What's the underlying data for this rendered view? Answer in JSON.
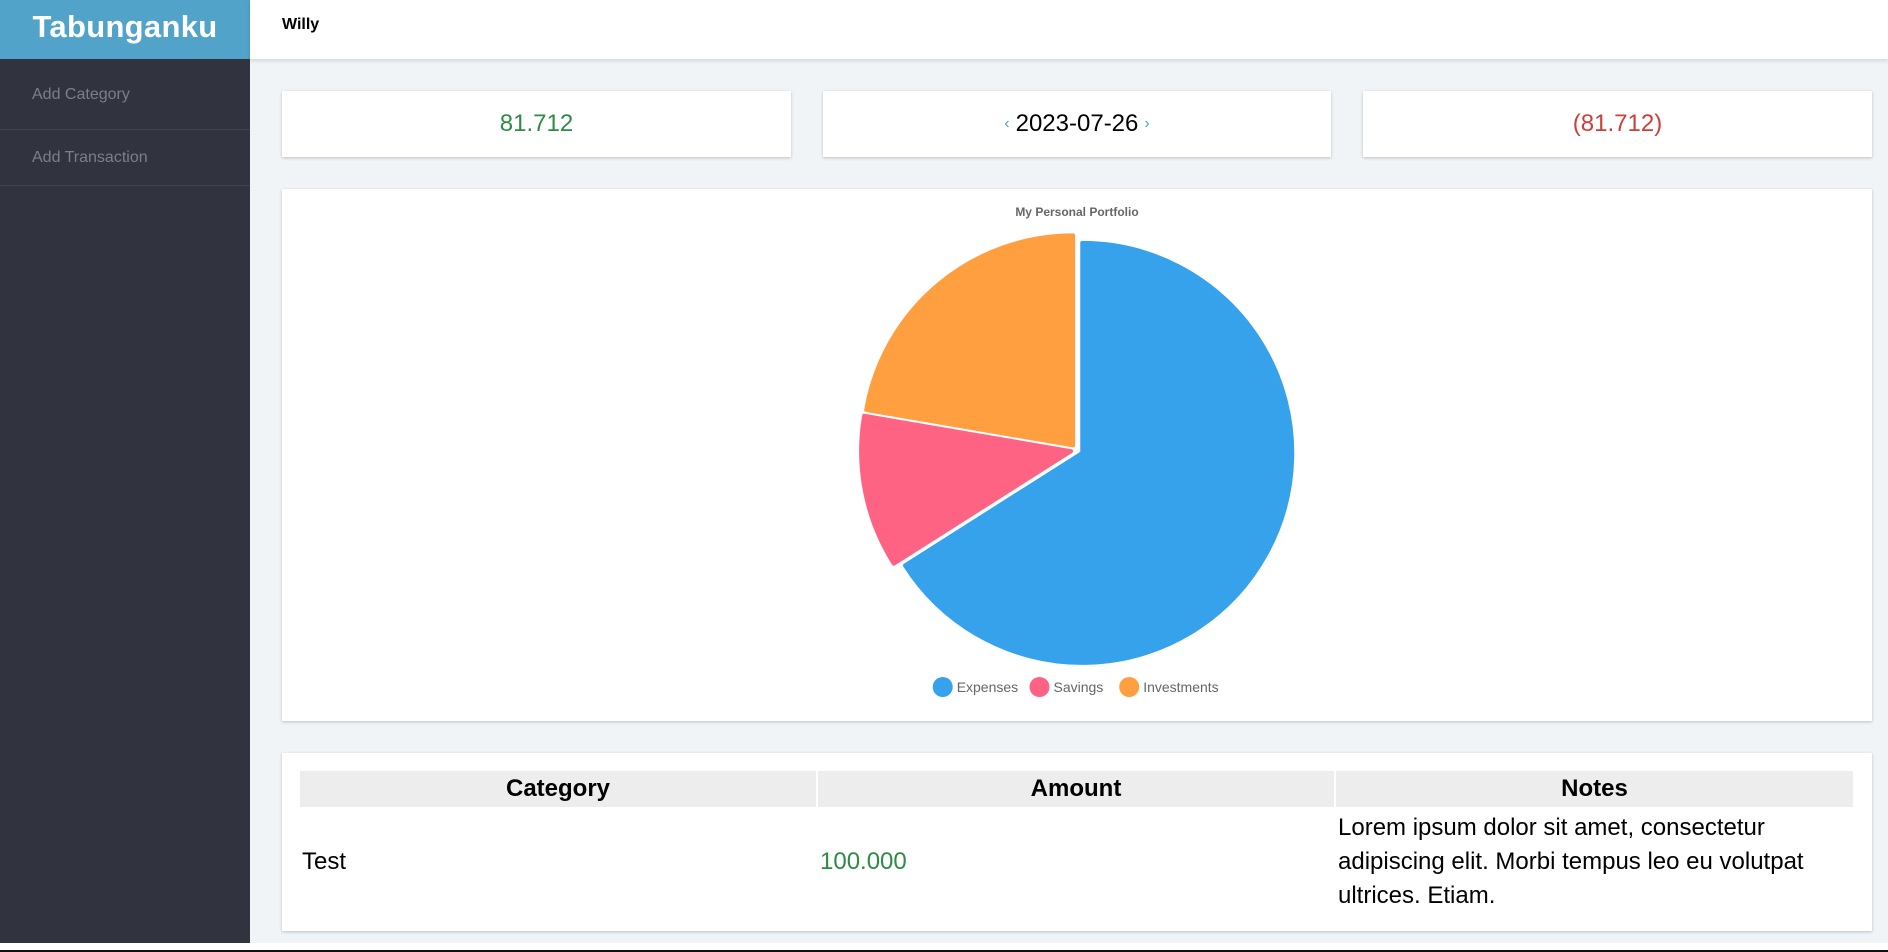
{
  "app": {
    "title": "Tabunganku"
  },
  "header": {
    "user_name": "Willy"
  },
  "sidebar": {
    "items": [
      {
        "label": "Add Category"
      },
      {
        "label": "Add Transaction"
      }
    ]
  },
  "summary": {
    "income": "81.712",
    "date": "2023-07-26",
    "prev_icon": "‹",
    "next_icon": "›",
    "balance": "(81.712)",
    "colors": {
      "income": "#2e8b47",
      "balance": "#c9413a",
      "nav": "#4aa3d6"
    }
  },
  "chart_data": {
    "type": "pie",
    "title": "My Personal Portfolio",
    "categories": [
      "Expenses",
      "Savings",
      "Investments"
    ],
    "values": [
      66.0,
      11.7,
      22.3
    ],
    "value_unit": "percent (estimated from slice angles)",
    "colors": [
      "#36a2eb",
      "#ff6384",
      "#ff9f40"
    ],
    "legend": "bottom"
  },
  "table": {
    "headers": [
      "Category",
      "Amount",
      "Notes"
    ],
    "rows": [
      {
        "category": "Test",
        "amount": "100.000",
        "notes": "Lorem ipsum dolor sit amet, consectetur adipiscing elit. Morbi tempus leo eu volutpat ultrices. Etiam."
      }
    ]
  }
}
